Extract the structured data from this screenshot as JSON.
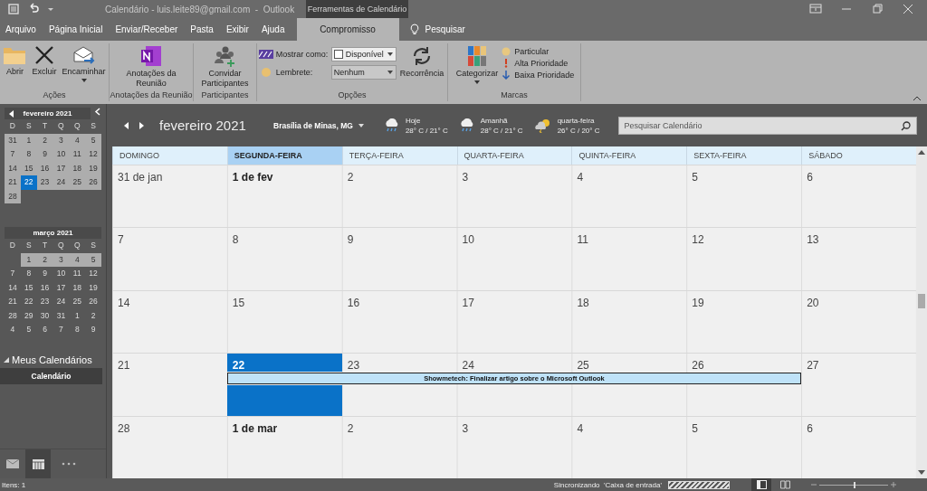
{
  "title_bar": {
    "title": "Calendário - luis.leite89@gmail.com  -  Outlook",
    "context_tab": "Ferramentas de Calendário"
  },
  "menu_tabs": [
    {
      "label": "Arquivo",
      "selected": false
    },
    {
      "label": "Página Inicial",
      "selected": false
    },
    {
      "label": "Enviar/Receber",
      "selected": false
    },
    {
      "label": "Pasta",
      "selected": false
    },
    {
      "label": "Exibir",
      "selected": false
    },
    {
      "label": "Ajuda",
      "selected": false
    },
    {
      "label": "Compromisso",
      "selected": true
    }
  ],
  "tell_me": "Pesquisar",
  "ribbon": {
    "groups": [
      {
        "label": "Ações",
        "buttons": [
          {
            "label": "Abrir",
            "menu": false
          },
          {
            "label": "Excluir",
            "menu": false
          },
          {
            "label": "Encaminhar",
            "menu": true
          }
        ]
      },
      {
        "label": "Anotações da Reunião",
        "buttons": [
          {
            "label": "Anotações da Reunião",
            "menu": false
          }
        ]
      },
      {
        "label": "Participantes",
        "buttons": [
          {
            "label": "Convidar Participantes",
            "menu": false
          }
        ]
      },
      {
        "label": "Opções",
        "show_as": {
          "label": "Mostrar como:",
          "value": "Disponível"
        },
        "reminder": {
          "label": "Lembrete:",
          "value": "Nenhum"
        },
        "buttons": [
          {
            "label": "Recorrência",
            "menu": false
          }
        ]
      },
      {
        "label": "Marcas",
        "buttons": [
          {
            "label": "Categorizar",
            "menu": true
          }
        ],
        "small_buttons": [
          "Particular",
          "Alta Prioridade",
          "Baixa Prioridade"
        ]
      }
    ]
  },
  "mini_calendars": [
    {
      "title": "fevereiro 2021",
      "nav": true,
      "weekdays": [
        "D",
        "S",
        "T",
        "Q",
        "Q",
        "S"
      ],
      "weeks": [
        [
          {
            "day": "31",
            "shaded": true,
            "selected": false
          },
          {
            "day": "1",
            "shaded": true,
            "selected": false
          },
          {
            "day": "2",
            "shaded": true,
            "selected": false
          },
          {
            "day": "3",
            "shaded": true,
            "selected": false
          },
          {
            "day": "4",
            "shaded": true,
            "selected": false
          },
          {
            "day": "5",
            "shaded": true,
            "selected": false
          }
        ],
        [
          {
            "day": "7",
            "shaded": true,
            "selected": false
          },
          {
            "day": "8",
            "shaded": true,
            "selected": false
          },
          {
            "day": "9",
            "shaded": true,
            "selected": false
          },
          {
            "day": "10",
            "shaded": true,
            "selected": false
          },
          {
            "day": "11",
            "shaded": true,
            "selected": false
          },
          {
            "day": "12",
            "shaded": true,
            "selected": false
          }
        ],
        [
          {
            "day": "14",
            "shaded": true,
            "selected": false
          },
          {
            "day": "15",
            "shaded": true,
            "selected": false
          },
          {
            "day": "16",
            "shaded": true,
            "selected": false
          },
          {
            "day": "17",
            "shaded": true,
            "selected": false
          },
          {
            "day": "18",
            "shaded": true,
            "selected": false
          },
          {
            "day": "19",
            "shaded": true,
            "selected": false
          }
        ],
        [
          {
            "day": "21",
            "shaded": true,
            "selected": false
          },
          {
            "day": "22",
            "shaded": true,
            "selected": true
          },
          {
            "day": "23",
            "shaded": true,
            "selected": false
          },
          {
            "day": "24",
            "shaded": true,
            "selected": false
          },
          {
            "day": "25",
            "shaded": true,
            "selected": false
          },
          {
            "day": "26",
            "shaded": true,
            "selected": false
          }
        ],
        [
          {
            "day": "28",
            "shaded": true,
            "selected": false
          }
        ]
      ]
    },
    {
      "title": "março 2021",
      "nav": false,
      "weekdays": [
        "D",
        "S",
        "T",
        "Q",
        "Q",
        "S"
      ],
      "weeks": [
        [
          {
            "shaded": false,
            "selected": false
          },
          {
            "day": "1",
            "shaded": true,
            "selected": false
          },
          {
            "day": "2",
            "shaded": true,
            "selected": false
          },
          {
            "day": "3",
            "shaded": true,
            "selected": false
          },
          {
            "day": "4",
            "shaded": true,
            "selected": false
          },
          {
            "day": "5",
            "shaded": true,
            "selected": false
          }
        ],
        [
          {
            "day": "7",
            "shaded": false,
            "selected": false
          },
          {
            "day": "8",
            "shaded": false,
            "selected": false
          },
          {
            "day": "9",
            "shaded": false,
            "selected": false
          },
          {
            "day": "10",
            "shaded": false,
            "selected": false
          },
          {
            "day": "11",
            "shaded": false,
            "selected": false
          },
          {
            "day": "12",
            "shaded": false,
            "selected": false
          }
        ],
        [
          {
            "day": "14",
            "shaded": false,
            "selected": false
          },
          {
            "day": "15",
            "shaded": false,
            "selected": false
          },
          {
            "day": "16",
            "shaded": false,
            "selected": false
          },
          {
            "day": "17",
            "shaded": false,
            "selected": false
          },
          {
            "day": "18",
            "shaded": false,
            "selected": false
          },
          {
            "day": "19",
            "shaded": false,
            "selected": false
          }
        ],
        [
          {
            "day": "21",
            "shaded": false,
            "selected": false
          },
          {
            "day": "22",
            "shaded": false,
            "selected": false
          },
          {
            "day": "23",
            "shaded": false,
            "selected": false
          },
          {
            "day": "24",
            "shaded": false,
            "selected": false
          },
          {
            "day": "25",
            "shaded": false,
            "selected": false
          },
          {
            "day": "26",
            "shaded": false,
            "selected": false
          }
        ],
        [
          {
            "day": "28",
            "shaded": false,
            "selected": false
          },
          {
            "day": "29",
            "shaded": false,
            "selected": false
          },
          {
            "day": "30",
            "shaded": false,
            "selected": false
          },
          {
            "day": "31",
            "shaded": false,
            "selected": false
          },
          {
            "day": "1",
            "shaded": false,
            "selected": false
          },
          {
            "day": "2",
            "shaded": false,
            "selected": false
          }
        ],
        [
          {
            "day": "4",
            "shaded": false,
            "selected": false
          },
          {
            "day": "5",
            "shaded": false,
            "selected": false
          },
          {
            "day": "6",
            "shaded": false,
            "selected": false
          },
          {
            "day": "7",
            "shaded": false,
            "selected": false
          },
          {
            "day": "8",
            "shaded": false,
            "selected": false
          },
          {
            "day": "9",
            "shaded": false,
            "selected": false
          }
        ]
      ]
    }
  ],
  "folders": {
    "heading": "Meus Calendários",
    "expanded": true,
    "items": [
      {
        "label": "Calendário",
        "selected": true
      }
    ]
  },
  "nav_bar": [
    {
      "kind": "mail",
      "selected": false
    },
    {
      "kind": "calendar",
      "selected": true
    },
    {
      "kind": "more",
      "selected": false
    }
  ],
  "view_header": {
    "month": "fevereiro 2021",
    "location": "Brasília de Minas, MG",
    "forecast": [
      {
        "day": "Hoje",
        "temps": "28° C / 21° C",
        "kind": "rain"
      },
      {
        "day": "Amanhã",
        "temps": "28° C / 21° C",
        "kind": "rain"
      },
      {
        "day": "quarta-feira",
        "temps": "26° C / 20° C",
        "kind": "storm-sun"
      }
    ],
    "search": {
      "placeholder": "Pesquisar Calendário"
    }
  },
  "weekdays": [
    {
      "label": "DOMINGO",
      "selected": false
    },
    {
      "label": "SEGUNDA-FEIRA",
      "selected": true
    },
    {
      "label": "TERÇA-FEIRA",
      "selected": false
    },
    {
      "label": "QUARTA-FEIRA",
      "selected": false
    },
    {
      "label": "QUINTA-FEIRA",
      "selected": false
    },
    {
      "label": "SEXTA-FEIRA",
      "selected": false
    },
    {
      "label": "SÁBADO",
      "selected": false
    }
  ],
  "weeks": [
    {
      "days": [
        {
          "label": "31 de jan",
          "bold": false,
          "selected": false,
          "in_event": false
        },
        {
          "label": "1 de fev",
          "bold": true,
          "selected": false,
          "in_event": false
        },
        {
          "label": "2",
          "bold": false,
          "selected": false,
          "in_event": false
        },
        {
          "label": "3",
          "bold": false,
          "selected": false,
          "in_event": false
        },
        {
          "label": "4",
          "bold": false,
          "selected": false,
          "in_event": false
        },
        {
          "label": "5",
          "bold": false,
          "selected": false,
          "in_event": false
        },
        {
          "label": "6",
          "bold": false,
          "selected": false,
          "in_event": false
        }
      ]
    },
    {
      "days": [
        {
          "label": "7",
          "bold": false,
          "selected": false,
          "in_event": false
        },
        {
          "label": "8",
          "bold": false,
          "selected": false,
          "in_event": false
        },
        {
          "label": "9",
          "bold": false,
          "selected": false,
          "in_event": false
        },
        {
          "label": "10",
          "bold": false,
          "selected": false,
          "in_event": false
        },
        {
          "label": "11",
          "bold": false,
          "selected": false,
          "in_event": false
        },
        {
          "label": "12",
          "bold": false,
          "selected": false,
          "in_event": false
        },
        {
          "label": "13",
          "bold": false,
          "selected": false,
          "in_event": false
        }
      ]
    },
    {
      "days": [
        {
          "label": "14",
          "bold": false,
          "selected": false,
          "in_event": false
        },
        {
          "label": "15",
          "bold": false,
          "selected": false,
          "in_event": false
        },
        {
          "label": "16",
          "bold": false,
          "selected": false,
          "in_event": false
        },
        {
          "label": "17",
          "bold": false,
          "selected": false,
          "in_event": false
        },
        {
          "label": "18",
          "bold": false,
          "selected": false,
          "in_event": false
        },
        {
          "label": "19",
          "bold": false,
          "selected": false,
          "in_event": false
        },
        {
          "label": "20",
          "bold": false,
          "selected": false,
          "in_event": false
        }
      ]
    },
    {
      "event_title": "Showmetech: Finalizar artigo sobre o Microsoft Outlook",
      "days": [
        {
          "label": "21",
          "bold": false,
          "selected": false,
          "in_event": false
        },
        {
          "label": "22",
          "bold": true,
          "selected": true,
          "in_event": true
        },
        {
          "label": "23",
          "bold": false,
          "selected": false,
          "in_event": true
        },
        {
          "label": "24",
          "bold": false,
          "selected": false,
          "in_event": true
        },
        {
          "label": "25",
          "bold": false,
          "selected": false,
          "in_event": true
        },
        {
          "label": "26",
          "bold": false,
          "selected": false,
          "in_event": true
        },
        {
          "label": "27",
          "bold": false,
          "selected": false,
          "in_event": false
        }
      ]
    },
    {
      "days": [
        {
          "label": "28",
          "bold": false,
          "selected": false,
          "in_event": false
        },
        {
          "label": "1 de mar",
          "bold": true,
          "selected": false,
          "in_event": false
        },
        {
          "label": "2",
          "bold": false,
          "selected": false,
          "in_event": false
        },
        {
          "label": "3",
          "bold": false,
          "selected": false,
          "in_event": false
        },
        {
          "label": "4",
          "bold": false,
          "selected": false,
          "in_event": false
        },
        {
          "label": "5",
          "bold": false,
          "selected": false,
          "in_event": false
        },
        {
          "label": "6",
          "bold": false,
          "selected": false,
          "in_event": false
        }
      ]
    }
  ],
  "status_bar": {
    "items": "Itens: 1",
    "sync": "Sincronizando  'Caixa de entrada'",
    "sync_progress": {
      "level": 1
    },
    "views": [
      {
        "kind": "normal",
        "selected": true
      },
      {
        "kind": "reading",
        "selected": false
      }
    ],
    "zoom": {
      "level": 0.5
    }
  }
}
